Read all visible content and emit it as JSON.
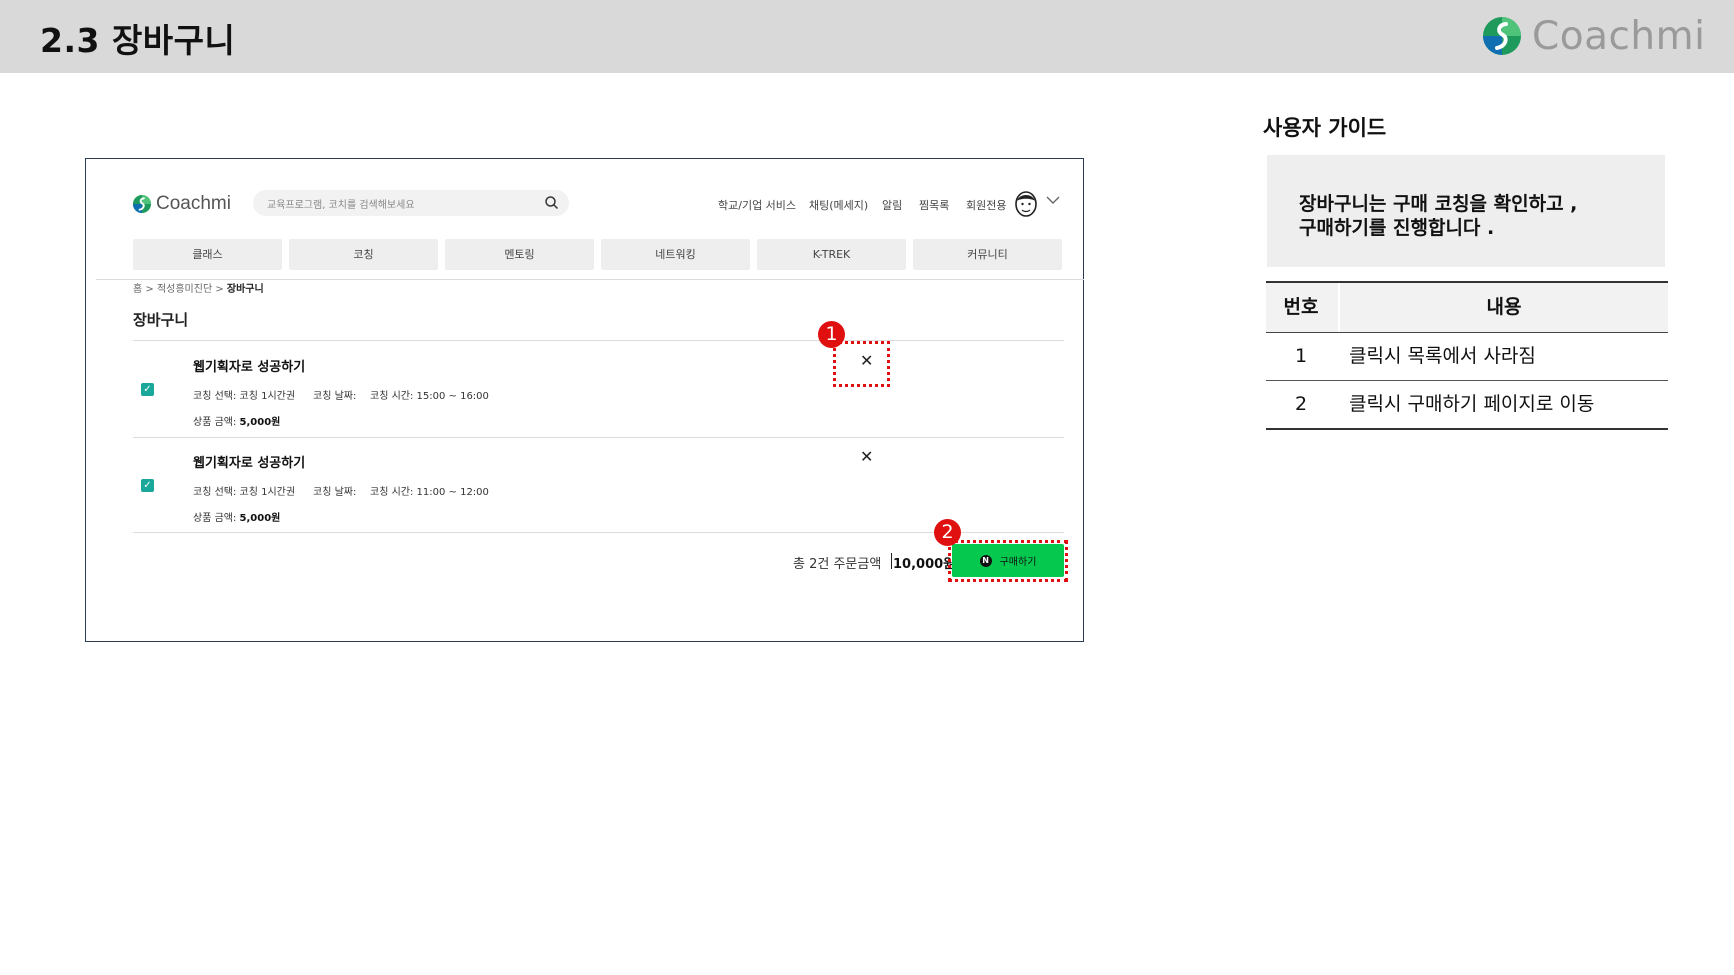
{
  "slide": {
    "title": "2.3  장바구니",
    "brand": "Coachmi"
  },
  "mockup": {
    "logo_text": "Coachmi",
    "search_placeholder": "교육프로그램, 코치를 검색해보세요",
    "top_nav": [
      "학교/기업 서비스",
      "채팅(메세지)",
      "알림",
      "찜목록",
      "회원전용"
    ],
    "categories": [
      "클래스",
      "코칭",
      "멘토링",
      "네트워킹",
      "K-TREK",
      "커뮤니티"
    ],
    "breadcrumb": {
      "home": "홈",
      "middle": "적성흥미진단",
      "current": "장바구니"
    },
    "cart_heading": "장바구니",
    "items": [
      {
        "title": "웹기획자로 성공하기",
        "coaching_select": "코칭 선택: 코칭 1시간권",
        "coaching_date": "코칭 날짜:",
        "coaching_time": "코칭 시간: 15:00 ~ 16:00",
        "price_label": "상품 금액:",
        "price": "5,000원",
        "checked": true
      },
      {
        "title": "웹기획자로 성공하기",
        "coaching_select": "코칭 선택: 코칭 1시간권",
        "coaching_date": "코칭 날짜:",
        "coaching_time": "코칭 시간: 11:00 ~ 12:00",
        "price_label": "상품 금액:",
        "price": "5,000원",
        "checked": true
      }
    ],
    "total_label": "총 2건 주문금액",
    "total_value": "10,000원",
    "buy_button": "구매하기",
    "buy_badge": "N",
    "markers": [
      "1",
      "2"
    ],
    "colors": {
      "buy_button": "#05c94e",
      "checkbox": "#1aa89a",
      "marker": "#e01010"
    }
  },
  "guide": {
    "title": "사용자 가이드",
    "description": [
      "장바구니는 구매 코칭을 확인하고 ,",
      "구매하기를 진행합니다 ."
    ],
    "table": {
      "headers": [
        "번호",
        "내용"
      ],
      "rows": [
        [
          "1",
          "클릭시 목록에서 사라짐"
        ],
        [
          "2",
          "클릭시 구매하기 페이지로 이동"
        ]
      ]
    }
  }
}
